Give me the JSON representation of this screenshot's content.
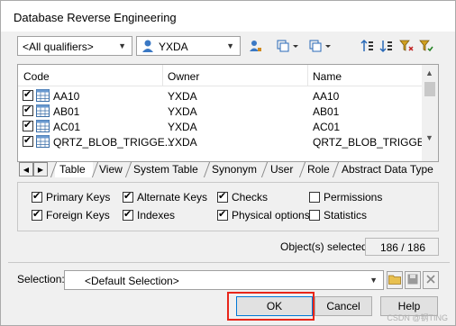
{
  "window": {
    "title": "Database Reverse Engineering"
  },
  "toolbar": {
    "qualifier": "<All qualifiers>",
    "owner": "YXDA"
  },
  "list": {
    "columns": [
      "Code",
      "Owner",
      "Name"
    ],
    "rows": [
      {
        "code": "AA10",
        "owner": "YXDA",
        "name": "AA10"
      },
      {
        "code": "AB01",
        "owner": "YXDA",
        "name": "AB01"
      },
      {
        "code": "AC01",
        "owner": "YXDA",
        "name": "AC01"
      },
      {
        "code": "QRTZ_BLOB_TRIGGE...",
        "owner": "YXDA",
        "name": "QRTZ_BLOB_TRIGGERS"
      }
    ]
  },
  "tabs": [
    "Table",
    "View",
    "System Table",
    "Synonym",
    "User",
    "Role",
    "Abstract Data Type"
  ],
  "options": [
    {
      "label": "Primary Keys",
      "checked": true
    },
    {
      "label": "Alternate Keys",
      "checked": true
    },
    {
      "label": "Checks",
      "checked": true
    },
    {
      "label": "Permissions",
      "checked": false
    },
    {
      "label": "Foreign Keys",
      "checked": true
    },
    {
      "label": "Indexes",
      "checked": true
    },
    {
      "label": "Physical options",
      "checked": true
    },
    {
      "label": "Statistics",
      "checked": false
    }
  ],
  "status": {
    "label": "Object(s) selected:",
    "value": "186 / 186"
  },
  "selection": {
    "label": "Selection:",
    "value": "<Default Selection>"
  },
  "buttons": {
    "ok": "OK",
    "cancel": "Cancel",
    "help": "Help"
  },
  "watermark": "CSDN @钢TING",
  "colors": {
    "highlight": "#e8261a",
    "focus": "#0078d7"
  }
}
